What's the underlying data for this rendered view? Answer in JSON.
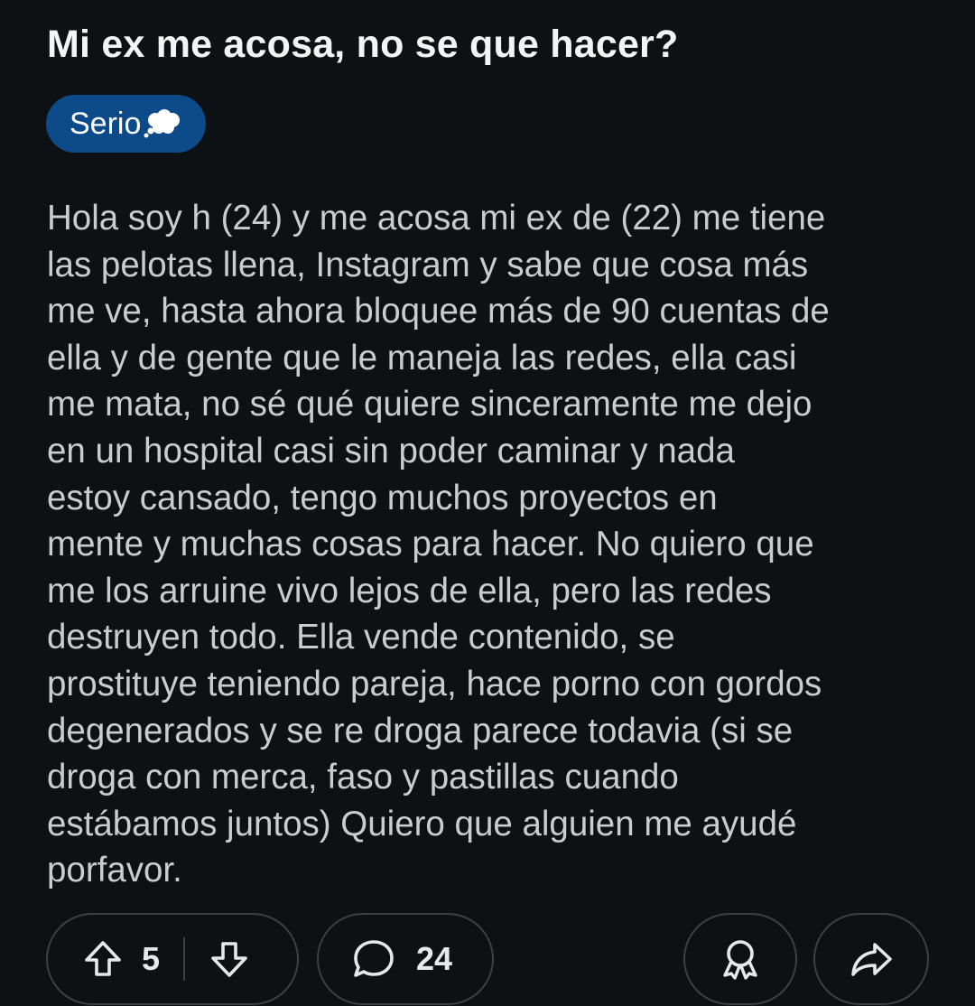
{
  "post": {
    "title": "Mi ex me acosa, no se que hacer?",
    "flair": {
      "label": "Serio",
      "emoji_icon": "thought-balloon-icon",
      "background_color": "#0c4a8a"
    },
    "body": "Hola soy h (24) y me acosa mi ex de (22) me tiene\nlas pelotas llena, Instagram y sabe que cosa más\nme ve, hasta ahora bloquee más de 90 cuentas de\nella y de gente que le maneja las redes, ella casi\nme mata, no sé qué quiere sinceramente me dejo\nen un hospital casi sin poder caminar y nada\nestoy cansado, tengo muchos proyectos en\nmente y muchas cosas para hacer. No quiero que\nme los arruine vivo lejos de ella, pero las redes\ndestruyen todo. Ella vende contenido, se\nprostituye teniendo pareja, hace porno con gordos\ndegenerados y se re droga parece todavia (si se\ndroga con merca, faso y pastillas cuando\nestábamos juntos) Quiero que alguien me ayudé\nporfavor."
  },
  "actions": {
    "score": "5",
    "comment_count": "24",
    "upvote_icon": "arrow-up-icon",
    "downvote_icon": "arrow-down-icon",
    "comment_icon": "speech-bubble-icon",
    "award_icon": "award-ribbon-icon",
    "share_icon": "share-arrow-icon"
  },
  "colors": {
    "background": "#0e1113",
    "button_border": "#3a4044",
    "text": "#c9cdd0"
  }
}
